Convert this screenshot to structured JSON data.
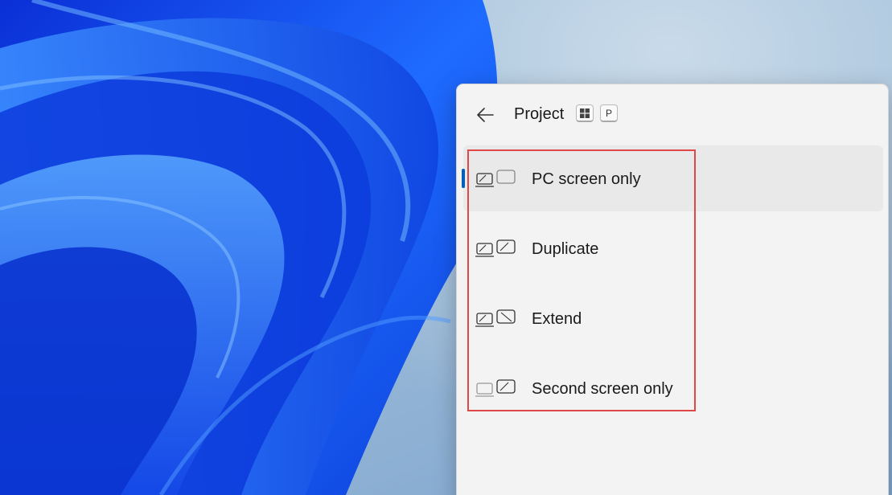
{
  "flyout": {
    "title": "Project",
    "shortcut_keys": [
      "⊞",
      "P"
    ],
    "options": [
      {
        "label": "PC screen only",
        "icon": "pc-screen-only-icon",
        "selected": true
      },
      {
        "label": "Duplicate",
        "icon": "duplicate-icon",
        "selected": false
      },
      {
        "label": "Extend",
        "icon": "extend-icon",
        "selected": false
      },
      {
        "label": "Second screen only",
        "icon": "second-screen-only-icon",
        "selected": false
      }
    ]
  },
  "colors": {
    "accent": "#005fb8",
    "annotation_border": "#e04848",
    "panel_background": "#f3f3f3",
    "wallpaper_blue": "#1a5cf0"
  }
}
